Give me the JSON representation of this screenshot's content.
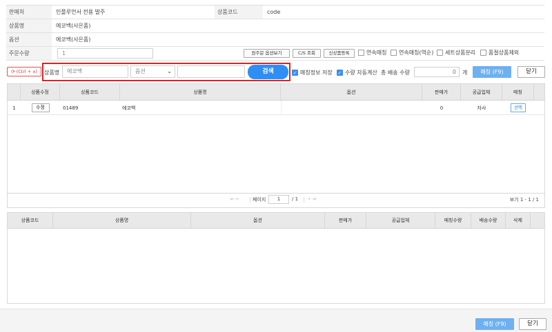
{
  "info": {
    "seller_label": "판매처",
    "seller_value": "인플루언서 전용 발주",
    "code_label": "상품코드",
    "code_value": "code",
    "product_label": "상품명",
    "product_value": "에코백(사은품)",
    "option_label": "옵션",
    "option_value": "에코백(사은품)",
    "qty_label": "주문수량",
    "qty_value": "1",
    "btn_view_original": "원주문 옵션보기",
    "btn_cs": "C/S 조회",
    "btn_new_product": "신상품등록",
    "chk_continuous": "연속매칭",
    "chk_continuous_reverse": "연속매칭(역순)",
    "chk_set_split": "세트상품분리",
    "chk_exclude_soldout": "품절상품제외"
  },
  "search": {
    "refresh_label": "(Ctrl + x)",
    "product_label": "상품명",
    "product_input": "에코백",
    "option_select": "옵션",
    "extra_input": "",
    "search_button": "검색",
    "save_matching_label": "매칭정보 저장",
    "auto_qty_label": "수량 자동계산",
    "total_qty_label": "총 배송 수량",
    "total_qty_value": "0",
    "unit": "개",
    "match_button": "매칭 (F9)",
    "close_button": "닫기"
  },
  "grid1": {
    "headers": [
      "상품수정",
      "상품코드",
      "상품명",
      "옵션",
      "판매가",
      "공급업체",
      "매칭"
    ],
    "rows": [
      {
        "num": "1",
        "edit": "수정",
        "code": "01489",
        "name": "에코백",
        "option": "",
        "price": "0",
        "supplier": "자사",
        "match": "선택"
      }
    ],
    "pager": {
      "page_label": "페이지",
      "page_value": "1",
      "of_total": "/ 1",
      "view_info": "보기 1 - 1 / 1"
    }
  },
  "grid2": {
    "headers": [
      "상품코드",
      "상품명",
      "옵션",
      "판매가",
      "공급업체",
      "매칭수량",
      "배송수량",
      "삭제"
    ]
  },
  "footer": {
    "match_button": "매칭 (F9)",
    "close_button": "닫기"
  }
}
